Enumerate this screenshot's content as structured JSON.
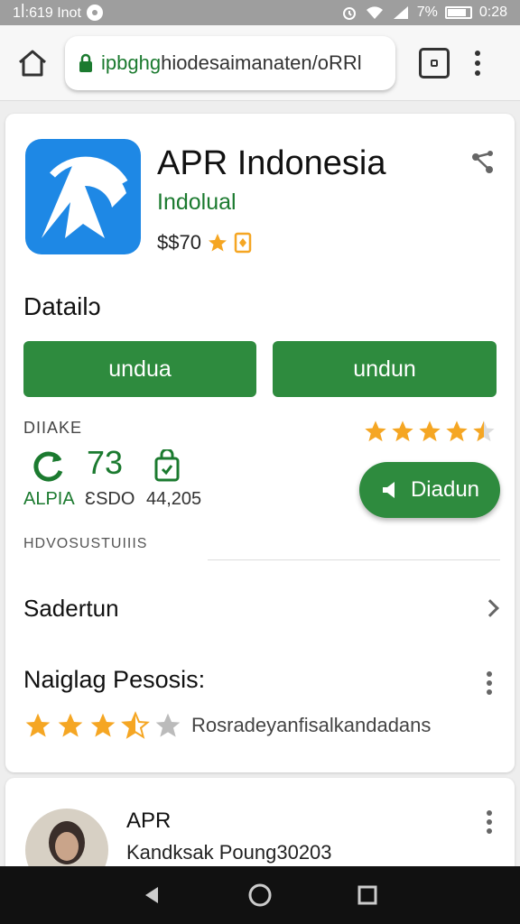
{
  "status_bar": {
    "time_left": "1ꟾ:619 Inot",
    "battery": "7%",
    "clock": "0:28"
  },
  "browser": {
    "url_host": "ipbghg",
    "url_rest": "hiodesaimanaten/oRRl",
    "home_icon": "home-icon",
    "lock_icon": "lock-icon"
  },
  "app": {
    "title": "APR Indonesia",
    "developer": "Indolual",
    "price": "$$70",
    "brand_color": "#1e88e5"
  },
  "details": {
    "heading": "Datailɔ",
    "button1": "undua",
    "button2": "undun"
  },
  "stats": {
    "header": "DIIAKE",
    "value": "73",
    "label_a": "ALPIA",
    "label_b": "ƐSDO",
    "label_c": "44,205",
    "rating_stars": 4.5,
    "pill_label": "Diadun"
  },
  "section": {
    "caption": "HDVOSUSTUIIIS",
    "row_label": "Sadertun"
  },
  "rating": {
    "title": "Naiglag Pesosis:",
    "stars": 3.5,
    "text": "Rosradeyanfisalkandadans"
  },
  "review": {
    "name": "APR",
    "subtitle": "Kandksak  Poung30203"
  },
  "colors": {
    "accent_green": "#2e8b3e",
    "star": "#f5a623"
  }
}
